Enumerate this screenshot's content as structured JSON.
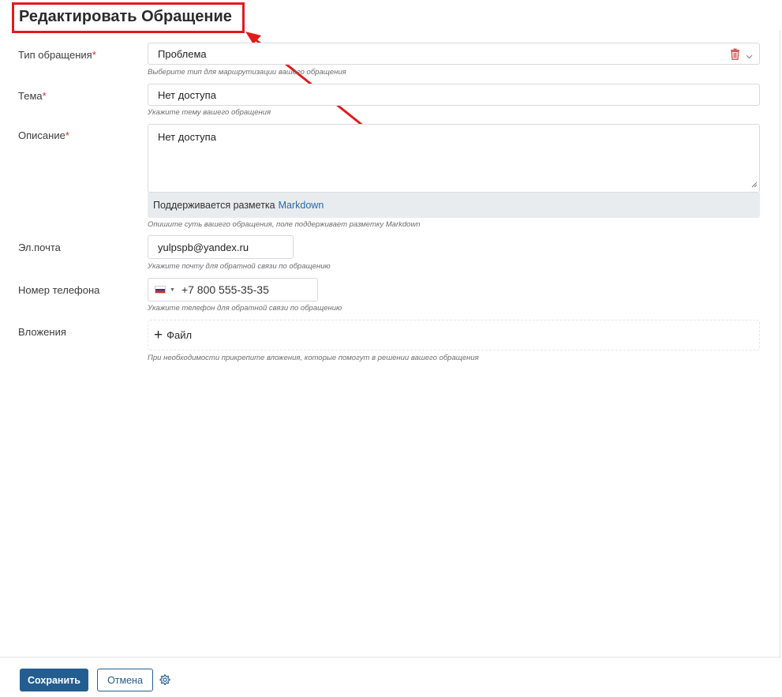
{
  "page": {
    "title": "Редактировать Обращение"
  },
  "fields": {
    "type": {
      "label": "Тип обращения",
      "required_mark": "*",
      "value": "Проблема",
      "hint": "Выберите тип для маршрутизации вашего обращения"
    },
    "subject": {
      "label": "Тема",
      "required_mark": "*",
      "value": "Нет доступа",
      "hint": "Укажите тему вашего обращения"
    },
    "description": {
      "label": "Описание",
      "required_mark": "*",
      "value": "Нет доступа",
      "markdown_note": "Поддерживается разметка",
      "markdown_link": "Markdown",
      "hint": "Опишите суть вашего обращения, поле поддерживает разметку Markdown"
    },
    "email": {
      "label": "Эл.почта",
      "value": "yulpspb@yandex.ru",
      "hint": "Укажите почту для обратной связи по обращению"
    },
    "phone": {
      "label": "Номер телефона",
      "value": "+7 800 555-35-35",
      "country_icon": "russia-flag-icon",
      "hint": "Укажите телефон для обратной связи по обращению"
    },
    "attachments": {
      "label": "Вложения",
      "button_label": "Файл",
      "hint": "При необходимости прикрепите вложения, которые помогут в решении вашего обращения"
    }
  },
  "footer": {
    "save_label": "Сохранить",
    "cancel_label": "Отмена",
    "settings_icon": "gear-icon"
  },
  "colors": {
    "primary": "#245d8f",
    "link": "#1e6ab0",
    "required": "#d93025",
    "annotation": "#e31a1c"
  }
}
